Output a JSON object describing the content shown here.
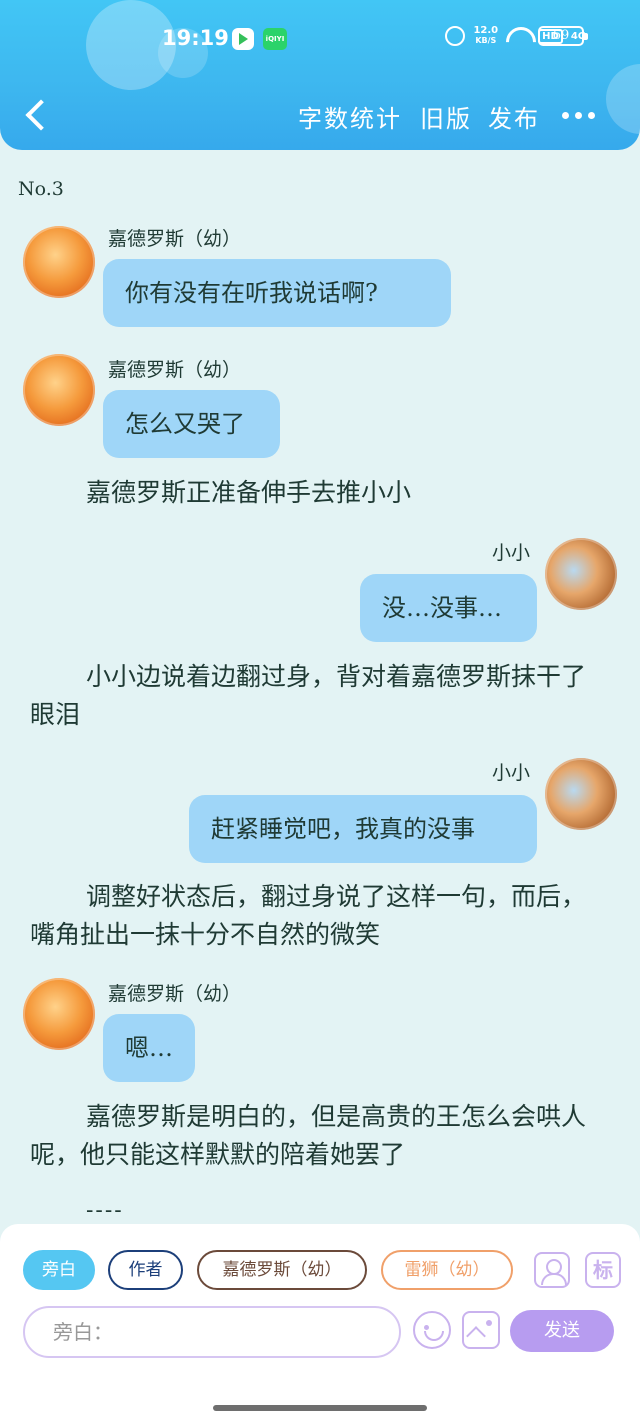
{
  "status_bar": {
    "time": "19:19",
    "app_icon_2_label": "iQIYI",
    "net_speed_value": "12.0",
    "net_speed_unit": "KB/S",
    "hd_label": "HD",
    "network_label": "4G",
    "battery": "69"
  },
  "header": {
    "word_count_label": "字数统计",
    "old_version_label": "旧版",
    "publish_label": "发布"
  },
  "chat": {
    "chapter_no": "No.3",
    "messages": [
      {
        "speaker": "嘉德罗斯（幼）",
        "text": "你有没有在听我说话啊?"
      },
      {
        "speaker": "嘉德罗斯（幼）",
        "text": "怎么又哭了"
      },
      {
        "narration": "嘉德罗斯正准备伸手去推小小"
      },
      {
        "speaker": "小小",
        "text": "没…没事…"
      },
      {
        "narration": "小小边说着边翻过身，背对着嘉德罗斯抹干了眼泪"
      },
      {
        "speaker": "小小",
        "text": "赶紧睡觉吧，我真的没事"
      },
      {
        "narration": "调整好状态后，翻过身说了这样一句，而后，嘴角扯出一抹十分不自然的微笑"
      },
      {
        "speaker": "嘉德罗斯（幼）",
        "text": "嗯…"
      },
      {
        "narration": "嘉德罗斯是明白的，但是高贵的王怎么会哄人呢，他只能这样默默的陪着她罢了"
      }
    ],
    "divider": "----"
  },
  "composer": {
    "roles": [
      "旁白",
      "作者",
      "嘉德罗斯（幼）",
      "雷狮（幼）"
    ],
    "tag_icon_label": "标",
    "input_placeholder": "旁白：",
    "send_label": "发送"
  },
  "colors": {
    "header_blue": "#3db6ef",
    "bubble_blue": "#9fd6f8",
    "background": "#e3f3f4",
    "send_purple": "#b79cf0"
  }
}
